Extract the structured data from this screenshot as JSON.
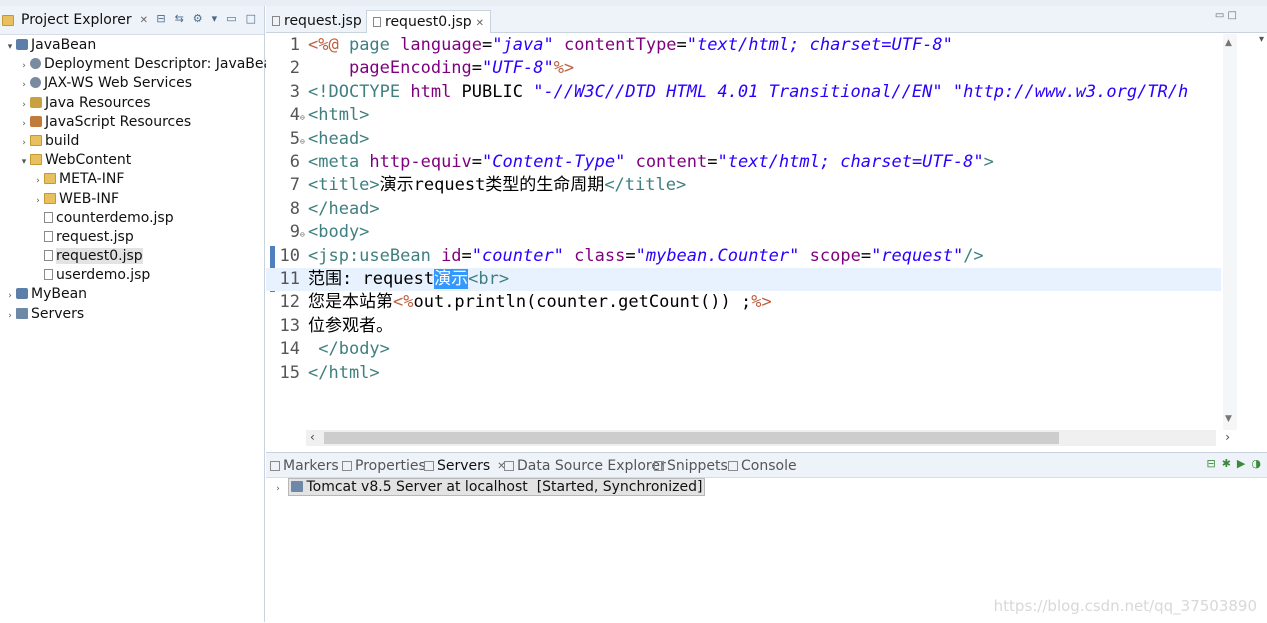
{
  "explorer": {
    "title": "Project Explorer",
    "tree": [
      {
        "label": "JavaBean",
        "indent": 0,
        "arrow": "▾",
        "icon": "project-icon",
        "selected": false
      },
      {
        "label": "Deployment Descriptor: JavaBean",
        "indent": 1,
        "arrow": "›",
        "icon": "gear-icon",
        "selected": false
      },
      {
        "label": "JAX-WS Web Services",
        "indent": 1,
        "arrow": "›",
        "icon": "gear-icon",
        "selected": false
      },
      {
        "label": "Java Resources",
        "indent": 1,
        "arrow": "›",
        "icon": "java-icon",
        "selected": false
      },
      {
        "label": "JavaScript Resources",
        "indent": 1,
        "arrow": "›",
        "icon": "js-icon",
        "selected": false
      },
      {
        "label": "build",
        "indent": 1,
        "arrow": "›",
        "icon": "folder-icon",
        "selected": false
      },
      {
        "label": "WebContent",
        "indent": 1,
        "arrow": "▾",
        "icon": "folder-icon",
        "selected": false
      },
      {
        "label": "META-INF",
        "indent": 2,
        "arrow": "›",
        "icon": "folder-icon",
        "selected": false
      },
      {
        "label": "WEB-INF",
        "indent": 2,
        "arrow": "›",
        "icon": "folder-icon",
        "selected": false
      },
      {
        "label": "counterdemo.jsp",
        "indent": 2,
        "arrow": "",
        "icon": "file-icon",
        "selected": false
      },
      {
        "label": "request.jsp",
        "indent": 2,
        "arrow": "",
        "icon": "file-icon",
        "selected": false
      },
      {
        "label": "request0.jsp",
        "indent": 2,
        "arrow": "",
        "icon": "file-icon",
        "selected": true
      },
      {
        "label": "userdemo.jsp",
        "indent": 2,
        "arrow": "",
        "icon": "file-icon",
        "selected": false
      },
      {
        "label": "MyBean",
        "indent": 0,
        "arrow": "›",
        "icon": "project-icon",
        "selected": false
      },
      {
        "label": "Servers",
        "indent": 0,
        "arrow": "›",
        "icon": "server-icon",
        "selected": false
      }
    ]
  },
  "editor": {
    "tabs": [
      {
        "label": "request.jsp",
        "active": false
      },
      {
        "label": "request0.jsp",
        "active": true
      }
    ],
    "lines": [
      {
        "n": "1",
        "marker": "",
        "current": false,
        "tokens": [
          [
            "dir",
            "<%@ "
          ],
          [
            "t",
            "page "
          ],
          [
            "a",
            "language"
          ],
          [
            "p",
            "="
          ],
          [
            "v",
            "\"java\""
          ],
          [
            "p",
            " "
          ],
          [
            "a",
            "contentType"
          ],
          [
            "p",
            "="
          ],
          [
            "v",
            "\"text/html; charset=UTF-8\""
          ]
        ]
      },
      {
        "n": "2",
        "marker": "",
        "current": false,
        "tokens": [
          [
            "p",
            "    "
          ],
          [
            "a",
            "pageEncoding"
          ],
          [
            "p",
            "="
          ],
          [
            "v",
            "\"UTF-8\""
          ],
          [
            "dir",
            "%>"
          ]
        ]
      },
      {
        "n": "3",
        "marker": "",
        "current": false,
        "tokens": [
          [
            "t",
            "<!DOCTYPE "
          ],
          [
            "a",
            "html "
          ],
          [
            "p",
            "PUBLIC "
          ],
          [
            "v",
            "\"-//W3C//DTD HTML 4.01 Transitional//EN\""
          ],
          [
            "p",
            " "
          ],
          [
            "v",
            "\"http://www.w3.org/TR/h"
          ]
        ]
      },
      {
        "n": "4",
        "marker": "⊖",
        "current": false,
        "tokens": [
          [
            "t",
            "<html>"
          ]
        ]
      },
      {
        "n": "5",
        "marker": "⊖",
        "current": false,
        "tokens": [
          [
            "t",
            "<head>"
          ]
        ]
      },
      {
        "n": "6",
        "marker": "",
        "current": false,
        "tokens": [
          [
            "t",
            "<meta "
          ],
          [
            "a",
            "http-equiv"
          ],
          [
            "p",
            "="
          ],
          [
            "v",
            "\"Content-Type\""
          ],
          [
            "p",
            " "
          ],
          [
            "a",
            "content"
          ],
          [
            "p",
            "="
          ],
          [
            "v",
            "\"text/html; charset=UTF-8\""
          ],
          [
            "t",
            ">"
          ]
        ]
      },
      {
        "n": "7",
        "marker": "",
        "current": false,
        "tokens": [
          [
            "t",
            "<title>"
          ],
          [
            "p",
            "演示request类型的生命周期"
          ],
          [
            "t",
            "</title>"
          ]
        ]
      },
      {
        "n": "8",
        "marker": "",
        "current": false,
        "tokens": [
          [
            "t",
            "</head>"
          ]
        ]
      },
      {
        "n": "9",
        "marker": "⊖",
        "current": false,
        "tokens": [
          [
            "t",
            "<body>"
          ]
        ]
      },
      {
        "n": "10",
        "marker": "",
        "current": false,
        "tokens": [
          [
            "t",
            "<jsp:useBean "
          ],
          [
            "a",
            "id"
          ],
          [
            "p",
            "="
          ],
          [
            "v",
            "\"counter\""
          ],
          [
            "p",
            " "
          ],
          [
            "a",
            "class"
          ],
          [
            "p",
            "="
          ],
          [
            "v",
            "\"mybean.Counter\""
          ],
          [
            "p",
            " "
          ],
          [
            "a",
            "scope"
          ],
          [
            "p",
            "="
          ],
          [
            "v",
            "\"request\""
          ],
          [
            "t",
            "/>"
          ]
        ]
      },
      {
        "n": "11",
        "marker": "",
        "current": true,
        "tokens": [
          [
            "p",
            "范围: request"
          ],
          [
            "hl",
            "演示"
          ],
          [
            "t",
            "<br>"
          ]
        ]
      },
      {
        "n": "12",
        "marker": "",
        "current": false,
        "tokens": [
          [
            "p",
            "您是本站第"
          ],
          [
            "dir",
            "<%"
          ],
          [
            "p",
            "out.println(counter.getCount()) ;"
          ],
          [
            "dir",
            "%>"
          ]
        ]
      },
      {
        "n": "13",
        "marker": "",
        "current": false,
        "tokens": [
          [
            "p",
            "位参观者。"
          ]
        ]
      },
      {
        "n": "14",
        "marker": "",
        "current": false,
        "tokens": [
          [
            "p",
            " "
          ],
          [
            "t",
            "</body>"
          ]
        ]
      },
      {
        "n": "15",
        "marker": "",
        "current": false,
        "tokens": [
          [
            "t",
            "</html>"
          ]
        ]
      }
    ]
  },
  "bottom": {
    "tabs": [
      {
        "label": "Markers",
        "active": false,
        "icon": "markers-icon"
      },
      {
        "label": "Properties",
        "active": false,
        "icon": "properties-icon"
      },
      {
        "label": "Servers",
        "active": true,
        "icon": "servers-icon"
      },
      {
        "label": "Data Source Explorer",
        "active": false,
        "icon": "datasource-icon"
      },
      {
        "label": "Snippets",
        "active": false,
        "icon": "snippets-icon"
      },
      {
        "label": "Console",
        "active": false,
        "icon": "console-icon"
      }
    ],
    "server": {
      "name": "Tomcat v8.5 Server at localhost",
      "status": "[Started, Synchronized]"
    }
  },
  "watermark": "https://blog.csdn.net/qq_37503890",
  "colors": {
    "tag": "#3f7f7f",
    "attribute": "#7f007f",
    "value": "#2a00ff",
    "directive": "#bf5f3f",
    "selection": "#3399ff",
    "current_line": "#e8f2fe"
  }
}
